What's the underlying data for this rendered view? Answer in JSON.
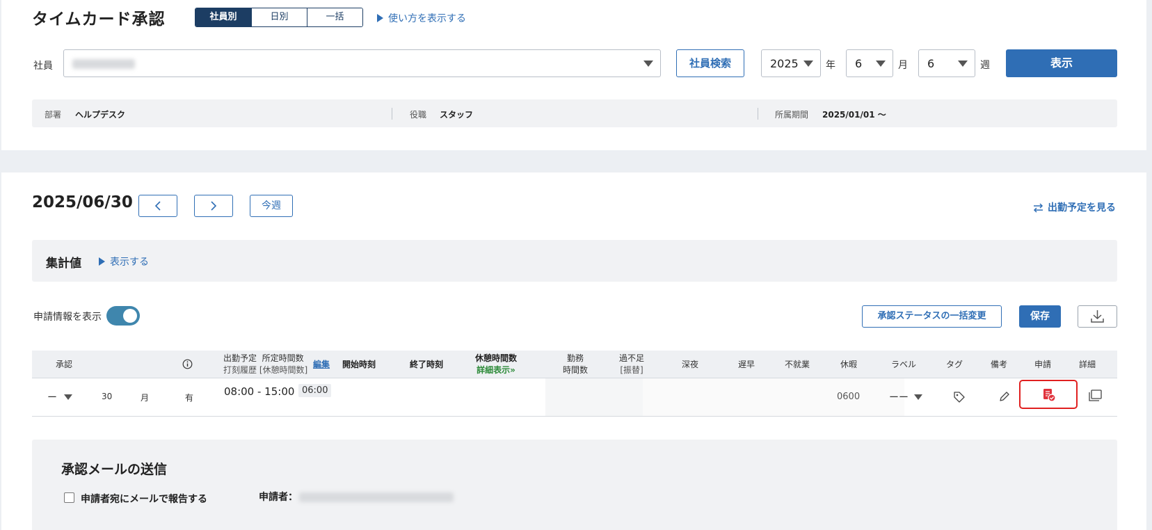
{
  "header": {
    "title": "タイムカード承認",
    "view_tabs": [
      "社員別",
      "日別",
      "一括"
    ],
    "howto_link": "使い方を表示する"
  },
  "filter": {
    "employee_label": "社員",
    "employee_value_redacted": "",
    "search_button": "社員検索",
    "year_value": "2025",
    "year_unit": "年",
    "month_value": "6",
    "month_unit": "月",
    "week_value": "6",
    "week_unit": "週",
    "display_button": "表示"
  },
  "info": {
    "dept_label": "部署",
    "dept_value": "ヘルプデスク",
    "role_label": "役職",
    "role_value": "スタッフ",
    "period_label": "所属期間",
    "period_value": "2025/01/01 〜"
  },
  "main": {
    "date": "2025/06/30",
    "this_week_button": "今週",
    "schedule_link": "出勤予定を見る",
    "summary_title": "集計値",
    "summary_link": "表示する",
    "toggle_label": "申請情報を表示",
    "bulk_status_button": "承認ステータスの一括変更",
    "save_button": "保存"
  },
  "table": {
    "headers": {
      "approve": "承認",
      "sched_line1": "出勤予定",
      "sched_line1b": "所定時間数",
      "sched_line2": "打刻履歴",
      "sched_line2b": "[休憩時間数]",
      "edit": "編集",
      "start": "開始時刻",
      "end": "終了時刻",
      "break_line1": "休憩時間数",
      "break_line2": "詳細表示»",
      "work_line1": "勤務",
      "work_line2": "時間数",
      "over_line1": "過不足",
      "over_line2": "[振替]",
      "night": "深夜",
      "late": "遅早",
      "absent": "不就業",
      "leave": "休暇",
      "label": "ラベル",
      "tag": "タグ",
      "note": "備考",
      "request": "申請",
      "detail": "詳細"
    },
    "row": {
      "approve_value": "ー",
      "day": "30",
      "weekday": "月",
      "type": "有",
      "sched_time": "08:00 - 15:00",
      "sched_hours": "06:00",
      "leave_value": "0600",
      "label_value": "ーー"
    }
  },
  "mail": {
    "title": "承認メールの送信",
    "checkbox_label": "申請者宛にメールで報告する",
    "applicant_label": "申請者："
  },
  "colors": {
    "primary": "#2f6eb5",
    "navy": "#1c3d63",
    "toggle": "#3f86ad",
    "request_icon": "#e0323c",
    "highlight_border": "#e02020",
    "break_link": "#2e8b3a"
  }
}
